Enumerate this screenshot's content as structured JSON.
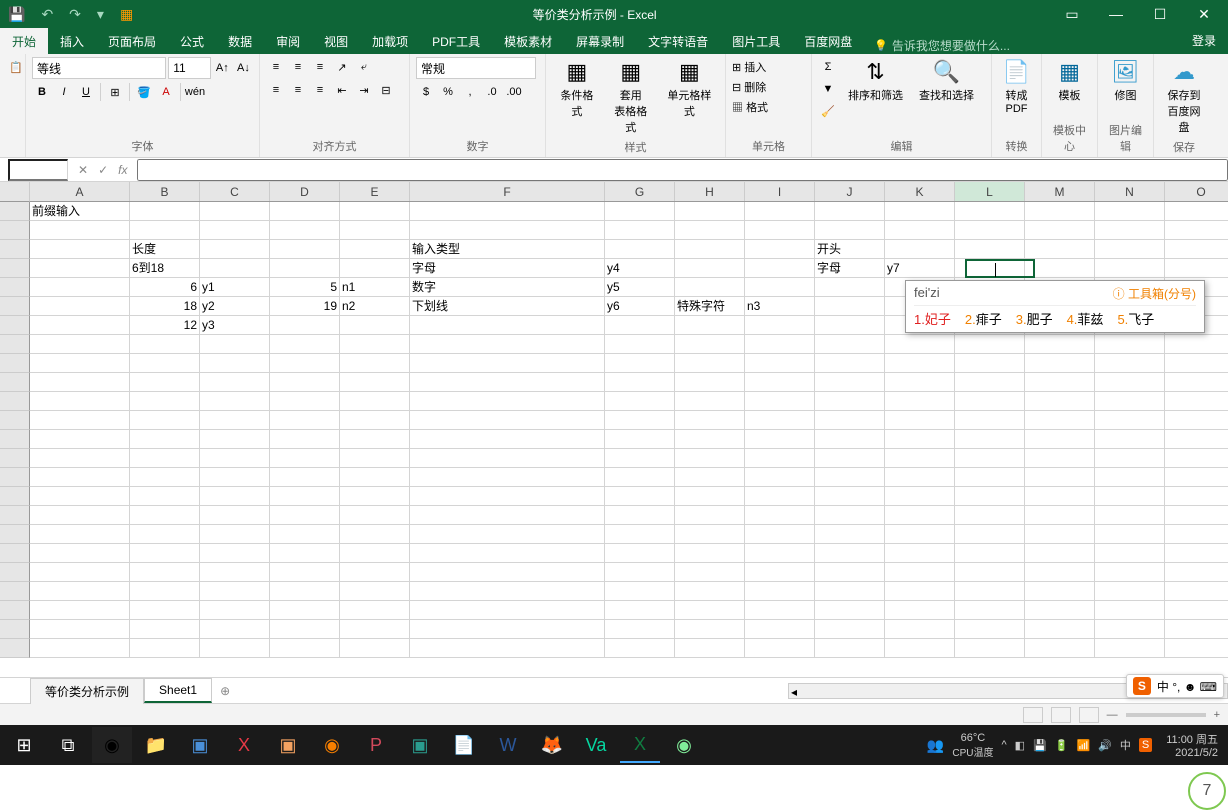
{
  "titlebar": {
    "title": "等价类分析示例 - Excel"
  },
  "tabs": {
    "items": [
      "开始",
      "插入",
      "页面布局",
      "公式",
      "数据",
      "审阅",
      "视图",
      "加载项",
      "PDF工具",
      "模板素材",
      "屏幕录制",
      "文字转语音",
      "图片工具",
      "百度网盘"
    ],
    "tellme": "告诉我您想要做什么...",
    "login": "登录"
  },
  "ribbon": {
    "font": {
      "name": "等线",
      "size": "11",
      "label": "字体"
    },
    "align": {
      "label": "对齐方式"
    },
    "number": {
      "format": "常规",
      "label": "数字"
    },
    "styles": {
      "cond": "条件格式",
      "table": "套用\n表格格式",
      "cell": "单元格样式",
      "label": "样式"
    },
    "cells": {
      "insert": "插入",
      "delete": "删除",
      "format": "格式",
      "label": "单元格"
    },
    "edit": {
      "sort": "排序和筛选",
      "find": "查找和选择",
      "label": "编辑"
    },
    "pdf": {
      "btn": "转成\nPDF",
      "label": "转换"
    },
    "tpl": {
      "btn": "模板",
      "label": "模板中心"
    },
    "img": {
      "btn": "修图",
      "label": "图片编辑"
    },
    "baidu": {
      "btn": "保存到\n百度网盘",
      "label": "保存"
    }
  },
  "formulaBar": {
    "name": "",
    "fx": "fx",
    "value": ""
  },
  "columns": [
    "A",
    "B",
    "C",
    "D",
    "E",
    "F",
    "G",
    "H",
    "I",
    "J",
    "K",
    "L",
    "M",
    "N",
    "O"
  ],
  "sheet": {
    "r1": {
      "A": "前缀输入"
    },
    "r3": {
      "B": "长度",
      "F": "输入类型",
      "J": "开头"
    },
    "r4": {
      "B": "6到18",
      "F": "字母",
      "G": "y4",
      "J": "字母",
      "K": "y7"
    },
    "r5": {
      "B": "6",
      "C": "y1",
      "D": "5",
      "E": "n1",
      "F": "数字",
      "G": "y5"
    },
    "r6": {
      "B": "18",
      "C": "y2",
      "D": "19",
      "E": "n2",
      "F": "下划线",
      "G": "y6",
      "H": "特殊字符",
      "I": "n3"
    },
    "r7": {
      "B": "12",
      "C": "y3"
    }
  },
  "ime": {
    "input": "fei'zi",
    "tool": "工具箱(分号)",
    "candidates": [
      {
        "n": "1",
        "w": "妃子"
      },
      {
        "n": "2",
        "w": "痱子"
      },
      {
        "n": "3",
        "w": "肥子"
      },
      {
        "n": "4",
        "w": "菲兹"
      },
      {
        "n": "5",
        "w": "飞子"
      }
    ]
  },
  "sheetTabs": {
    "t1": "等价类分析示例",
    "t2": "Sheet1"
  },
  "sogou": {
    "text": "中 °, ☻ ⌨"
  },
  "taskbar": {
    "temp": "66°C",
    "templbl": "CPU温度",
    "time": "11:00 周五",
    "date": "2021/5/2"
  },
  "circle": {
    "val": "7"
  }
}
